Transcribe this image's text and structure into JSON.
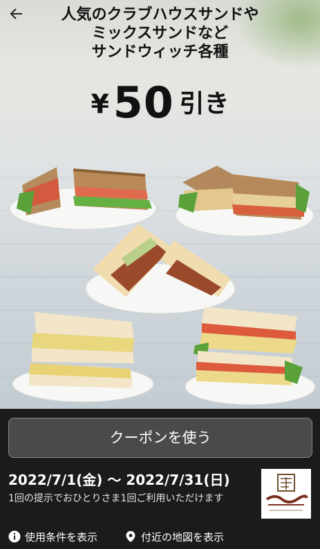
{
  "header": {
    "back_icon": "arrow-left-icon",
    "headline_lines": [
      "人気のクラブハウスサンドや",
      "ミックスサンドなど",
      "サンドウィッチ各種"
    ],
    "discount": {
      "yen": "¥",
      "amount": "50",
      "suffix": "引き"
    }
  },
  "images": {
    "sandwiches": [
      "sandwich-clubhouse-image",
      "sandwich-chicken-image",
      "sandwich-katsu-image",
      "sandwich-egg-mix-image",
      "sandwich-tomato-egg-image"
    ]
  },
  "coupon": {
    "use_button_label": "クーポンを使う",
    "period": "2022/7/1(金) 〜 2022/7/31(日)",
    "terms": "1回の提示でおひとりさま1回ご利用いただけます",
    "brand_logo": "ueshima-coffee-logo"
  },
  "footer": {
    "conditions": {
      "icon": "info-icon",
      "label": "使用条件を表示"
    },
    "map": {
      "icon": "location-pin-icon",
      "label": "付近の地図を表示"
    }
  },
  "colors": {
    "background": "#1b1b1b",
    "button": "#4a4a4a",
    "text_light": "#ffffff"
  }
}
